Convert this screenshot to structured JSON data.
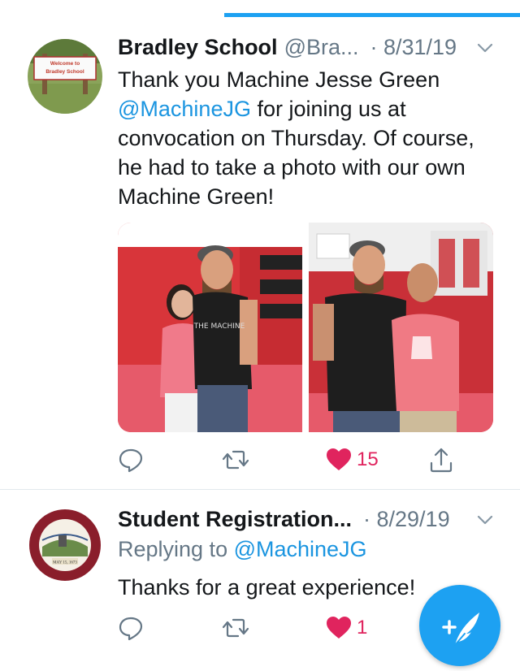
{
  "tweets": [
    {
      "name": "Bradley School",
      "handle": "@Bra...",
      "date": "· 8/31/19",
      "text_before": "Thank you Machine Jesse Green ",
      "mention": "@MachineJG",
      "text_after": " for joining us at convocation on Thursday. Of course, he had to take a photo with our own Machine Green!",
      "avatar_sign": {
        "line1": "Welcome to",
        "line2": "Bradley School"
      },
      "photo_shirt_text": "THE MACHINE",
      "likes": "15",
      "liked": true,
      "icons": [
        "reply-icon",
        "retweet-icon",
        "like-icon",
        "share-icon",
        "chevron-down-icon"
      ]
    },
    {
      "name": "Student Registration...",
      "date": "· 8/29/19",
      "replying_label": "Replying to ",
      "replying_handle": "@MachineJG",
      "text": "Thanks for a great experience!",
      "avatar_seal_date": "MAY 15, 1673",
      "likes": "1",
      "liked": true
    }
  ],
  "colors": {
    "accent": "#1da1f2",
    "link": "#1b95e0",
    "like": "#e0245e",
    "muted": "#657786",
    "text": "#14171a"
  },
  "fab": {
    "icon": "compose-feather-icon"
  }
}
